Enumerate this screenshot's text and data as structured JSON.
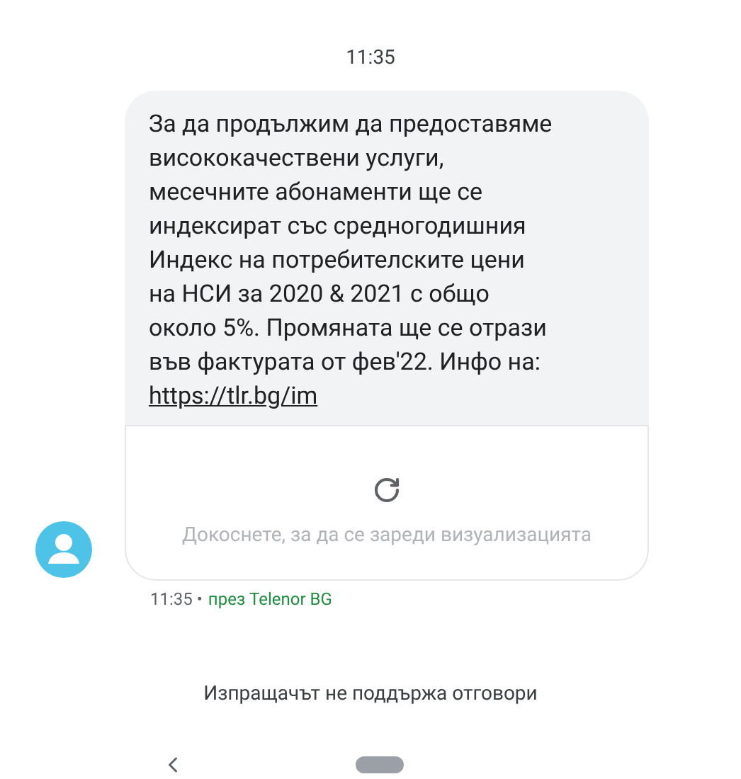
{
  "header": {
    "time": "11:35"
  },
  "message": {
    "lines": [
      "За да продължим да предоставяме",
      "висококачествени услуги,",
      "месечните абонаменти ще се",
      "индексират със средногодишния",
      "Индекс на потребителските цени",
      "на НСИ за 2020 & 2021 с общо",
      "около 5%. Промяната ще се отрази",
      "във фактурата от фев'22. Инфо на:"
    ],
    "link": "https://tlr.bg/im"
  },
  "preview": {
    "text": "Докоснете, за да се зареди визуализацията"
  },
  "meta": {
    "time": "11:35 •",
    "via": "през Telenor BG"
  },
  "footer": {
    "notice": "Изпращачът не поддържа отговори"
  }
}
